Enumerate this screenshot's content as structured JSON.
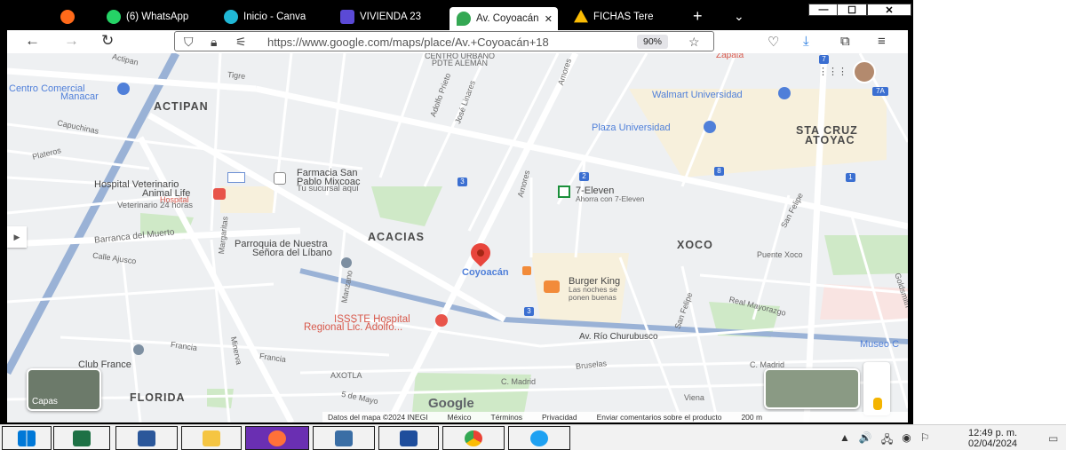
{
  "browser": {
    "tabs": [
      {
        "label": "",
        "icon": "firefox-icon"
      },
      {
        "label": "(6) WhatsApp",
        "icon": "whatsapp-icon"
      },
      {
        "label": "Inicio - Canva",
        "icon": "canva-icon"
      },
      {
        "label": "VIVIENDA 23",
        "icon": "forms-icon"
      },
      {
        "label": "Av. Coyoacán",
        "icon": "google-maps-icon",
        "active": true
      },
      {
        "label": "FICHAS Tere",
        "icon": "google-drive-icon"
      }
    ],
    "new_tab": "+",
    "tab_list": "⌄",
    "url": "https://www.google.com/maps/place/Av.+Coyoacán+18",
    "zoom": "90%",
    "window_controls": {
      "minimize": "—",
      "maximize": "☐",
      "close": "✕"
    }
  },
  "map": {
    "areas": [
      "ACTIPAN",
      "ACACIAS",
      "XOCO",
      "STA CRUZ",
      "ATOYAC",
      "FLORIDA"
    ],
    "places": {
      "centro_comercial": "Centro Comercial",
      "manacar": "Manacar",
      "walmart": "Walmart Universidad",
      "plaza": "Plaza Universidad",
      "hospital_vet": "Hospital Veterinario",
      "animal_life": "Animal Life",
      "hospital": "Hospital",
      "vet24": "Veterinario 24 horas",
      "farmacia1": "Farmacia San",
      "farmacia2": "Pablo Mixcoac",
      "farmacia_sub": "Tu sucursal aquí",
      "seven_eleven": "7-Eleven",
      "seven_sub": "Ahorra con 7-Eleven",
      "parroquia1": "Parroquia de Nuestra",
      "parroquia2": "Señora del Líbano",
      "coyoacan": "Coyoacán",
      "burger_king": "Burger King",
      "bk_sub1": "Las noches se",
      "bk_sub2": "ponen buenas",
      "issste1": "ISSSTE Hospital",
      "issste2": "Regional Lic. Adolfo...",
      "club_france": "Club France",
      "zapata": "Zapata",
      "museo": "Museo C"
    },
    "streets": {
      "actipan": "Actipan",
      "tigre": "Tigre",
      "capuchinas": "Capuchinas",
      "plateros": "Plateros",
      "barranca": "Barranca del Muerto",
      "calle_ajusco": "Calle Ajusco",
      "centro_urbano": "CENTRO URBANO",
      "pote_aleman": "PDTE ALEMÁN",
      "adolfo_prieto": "Adolfo Prieto",
      "jose_linares": "José Linares",
      "amores": "Amores",
      "puente_xoco": "Puente Xoco",
      "real_mayorazgo": "Real Mayorazgo",
      "av_rio": "Av. Río Churubusco",
      "francia": "Francia",
      "minerva": "Minerva",
      "axotla": "AXOTLA",
      "de_mayo": "5 de Mayo",
      "madrid": "C. Madrid",
      "bruselas": "Bruselas",
      "viena": "Viena",
      "san_felipe": "San Felipe",
      "goldsmith": "Goldsmith",
      "manzano": "Manzano",
      "margaritas": "Margaritas"
    },
    "route_shields": [
      "3",
      "2",
      "3",
      "8",
      "1",
      "7",
      "7A",
      "2",
      "3"
    ],
    "layers_label": "Capas",
    "google_logo": "Google",
    "footer": [
      "Datos del mapa ©2024 INEGI",
      "México",
      "Términos",
      "Privacidad",
      "Enviar comentarios sobre el producto",
      "200 m"
    ]
  },
  "taskbar": {
    "apps": [
      "windows-start",
      "excel",
      "word",
      "file-explorer",
      "firefox",
      "remote-desktop",
      "powershell",
      "chrome",
      "internet-explorer"
    ],
    "tray": [
      "▲",
      "🔊",
      "🖧",
      "◉",
      "⚐"
    ],
    "time": "12:49 p. m.",
    "date": "02/04/2024"
  }
}
